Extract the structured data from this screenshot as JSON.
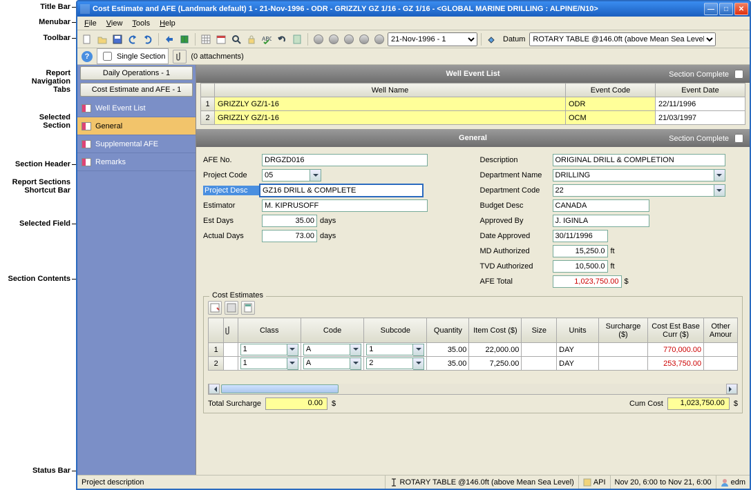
{
  "callouts": {
    "title_bar": "Title Bar",
    "menubar": "Menubar",
    "toolbar": "Toolbar",
    "report_nav_tabs": "Report\nNavigation\nTabs",
    "selected_section": "Selected\nSection",
    "section_header": "Section Header",
    "report_sections_shortcut_bar": "Report Sections\nShortcut Bar",
    "selected_field": "Selected Field",
    "section_contents": "Section Contents",
    "status_bar": "Status Bar"
  },
  "title": "Cost Estimate and AFE (Landmark default) 1 - 21-Nov-1996 - ODR - GRIZZLY GZ 1/16 - GZ 1/16 - <GLOBAL MARINE DRILLING : ALPINE/N10>",
  "menu": {
    "file": "File",
    "view": "View",
    "tools": "Tools",
    "help": "Help"
  },
  "toolbar": {
    "date_selector": "21-Nov-1996 - 1",
    "datum_label": "Datum",
    "datum_value": "ROTARY TABLE @146.0ft (above Mean Sea Level)"
  },
  "toolbar2": {
    "single_section": "Single Section",
    "attachments": "(0 attachments)"
  },
  "sidebar": {
    "tabs": [
      "Daily Operations - 1",
      "Cost Estimate and AFE - 1"
    ],
    "items": [
      "Well Event List",
      "General",
      "Supplemental AFE",
      "Remarks"
    ],
    "selected_index": 1
  },
  "well_event_list": {
    "header": "Well Event List",
    "section_complete": "Section Complete",
    "columns": [
      "Well Name",
      "Event Code",
      "Event Date"
    ],
    "rows": [
      {
        "n": "1",
        "well": "GRIZZLY GZ/1-16",
        "code": "ODR",
        "date": "22/11/1996"
      },
      {
        "n": "2",
        "well": "GRIZZLY GZ/1-16",
        "code": "OCM",
        "date": "21/03/1997"
      }
    ]
  },
  "general": {
    "header": "General",
    "section_complete": "Section Complete",
    "left": {
      "afe_no": {
        "label": "AFE No.",
        "value": "DRGZD016"
      },
      "project_code": {
        "label": "Project Code",
        "value": "05"
      },
      "project_desc": {
        "label": "Project Desc",
        "value": "GZ16 DRILL & COMPLETE"
      },
      "estimator": {
        "label": "Estimator",
        "value": "M. KIPRUSOFF"
      },
      "est_days": {
        "label": "Est Days",
        "value": "35.00",
        "unit": "days"
      },
      "actual_days": {
        "label": "Actual Days",
        "value": "73.00",
        "unit": "days"
      }
    },
    "right": {
      "description": {
        "label": "Description",
        "value": "ORIGINAL DRILL & COMPLETION"
      },
      "dept_name": {
        "label": "Department Name",
        "value": "DRILLING"
      },
      "dept_code": {
        "label": "Department Code",
        "value": "22"
      },
      "budget_desc": {
        "label": "Budget Desc",
        "value": "CANADA"
      },
      "approved_by": {
        "label": "Approved By",
        "value": "J. IGINLA"
      },
      "date_approved": {
        "label": "Date Approved",
        "value": "30/11/1996"
      },
      "md_authorized": {
        "label": "MD Authorized",
        "value": "15,250.0",
        "unit": "ft"
      },
      "tvd_authorized": {
        "label": "TVD Authorized",
        "value": "10,500.0",
        "unit": "ft"
      },
      "afe_total": {
        "label": "AFE Total",
        "value": "1,023,750.00",
        "unit": "$"
      }
    }
  },
  "cost_estimates": {
    "legend": "Cost Estimates",
    "columns": [
      "",
      "📎",
      "Class",
      "Code",
      "Subcode",
      "Quantity",
      "Item Cost ($)",
      "Size",
      "Units",
      "Surcharge ($)",
      "Cost Est Base Curr ($)",
      "Other Amour"
    ],
    "rows": [
      {
        "n": "1",
        "class": "1",
        "code": "A",
        "subcode": "1",
        "qty": "35.00",
        "item_cost": "22,000.00",
        "size": "",
        "units": "DAY",
        "surcharge": "",
        "cost_est": "770,000.00",
        "other": ""
      },
      {
        "n": "2",
        "class": "1",
        "code": "A",
        "subcode": "2",
        "qty": "35.00",
        "item_cost": "7,250.00",
        "size": "",
        "units": "DAY",
        "surcharge": "",
        "cost_est": "253,750.00",
        "other": ""
      }
    ],
    "total_surcharge": {
      "label": "Total Surcharge",
      "value": "0.00",
      "unit": "$"
    },
    "cum_cost": {
      "label": "Cum Cost",
      "value": "1,023,750.00",
      "unit": "$"
    }
  },
  "statusbar": {
    "left": "Project description",
    "datum": "ROTARY TABLE @146.0ft (above Mean Sea Level)",
    "api": "API",
    "range": "Nov 20, 6:00 to Nov 21, 6:00",
    "user": "edm"
  }
}
